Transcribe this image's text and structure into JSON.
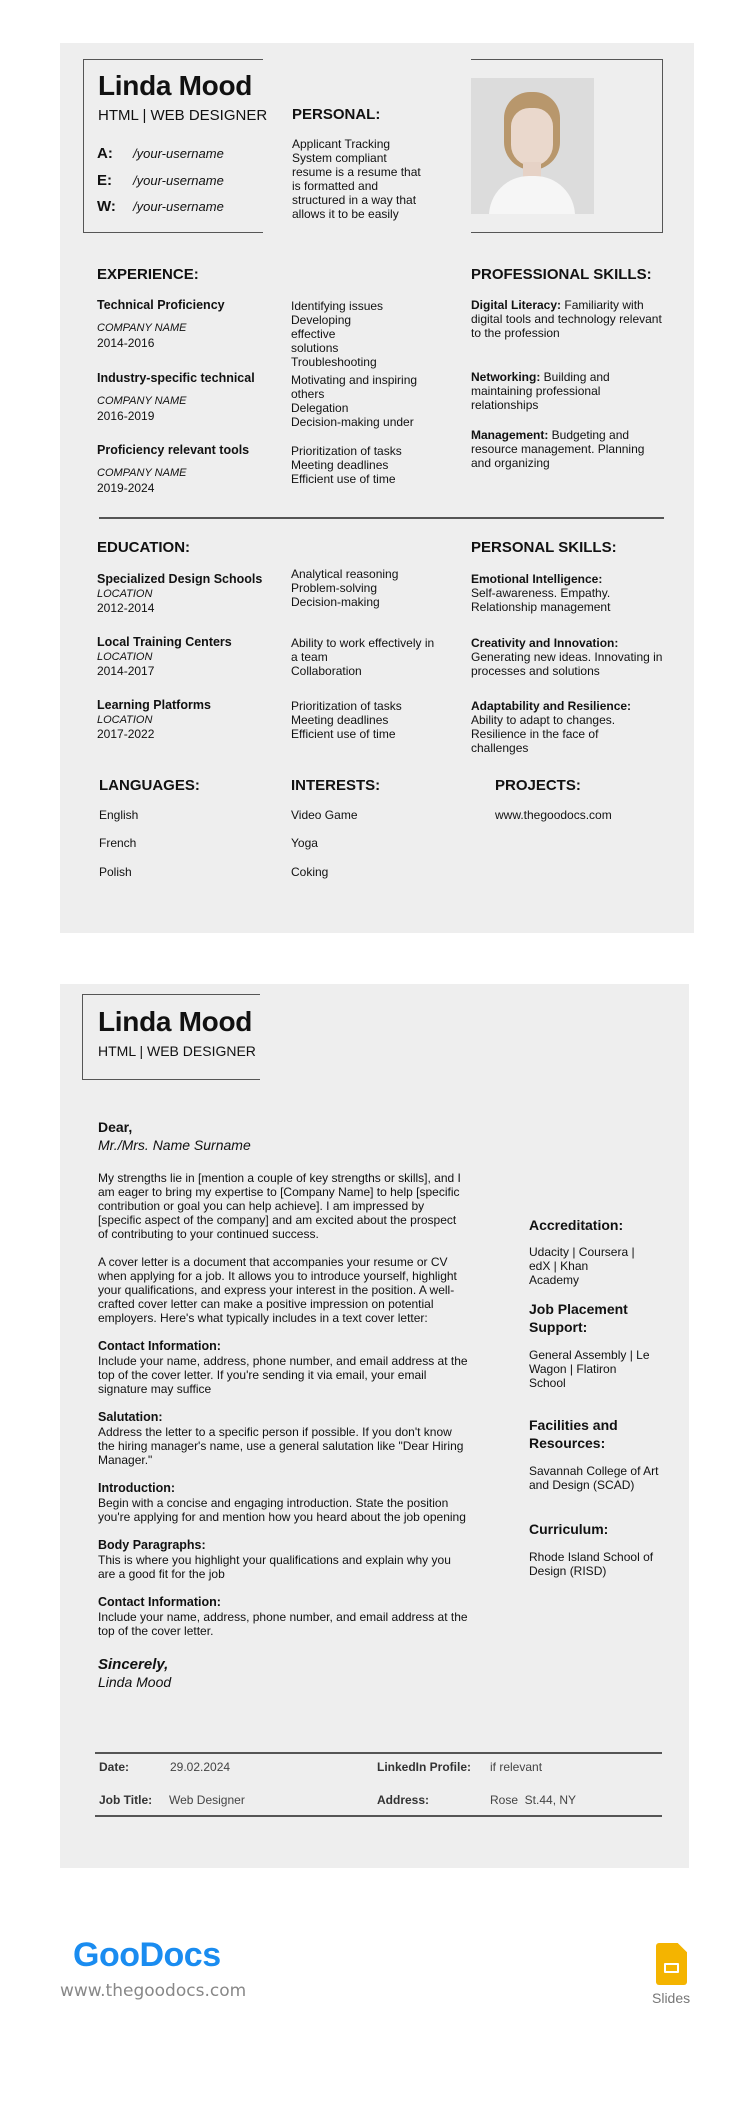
{
  "resume": {
    "name": "Linda Mood",
    "subtitle": "HTML | WEB DESIGNER",
    "contacts": [
      {
        "label": "A:",
        "value": "/your-username"
      },
      {
        "label": "E:",
        "value": "/your-username"
      },
      {
        "label": "W:",
        "value": "/your-username"
      }
    ],
    "personal": {
      "heading": "PERSONAL:",
      "text": "Applicant Tracking System compliant resume is a resume that is formatted and structured in a way that allows it to be easily"
    },
    "experience": {
      "heading": "EXPERIENCE:",
      "items": [
        {
          "title": "Technical Proficiency",
          "company": "COMPANY NAME",
          "years": "2014-2016",
          "skills": [
            "Identifying issues",
            "Developing effective solutions",
            "Troubleshooting"
          ]
        },
        {
          "title": "Industry-specific technical",
          "company": "COMPANY NAME",
          "years": "2016-2019",
          "skills": [
            "Motivating and inspiring others",
            "Delegation",
            "Decision-making under"
          ]
        },
        {
          "title": "Proficiency relevant tools",
          "company": "COMPANY NAME",
          "years": "2019-2024",
          "skills": [
            "Prioritization of tasks",
            "Meeting deadlines",
            "Efficient use of time"
          ]
        }
      ]
    },
    "professional_skills": {
      "heading": "PROFESSIONAL SKILLS:",
      "items": [
        {
          "title": "Digital Literacy:",
          "text": " Familiarity with digital tools and technology relevant to the profession"
        },
        {
          "title": "Networking:",
          "text": " Building and maintaining professional relationships"
        },
        {
          "title": "Management:",
          "text": " Budgeting and resource management. Planning and organizing"
        }
      ]
    },
    "education": {
      "heading": "EDUCATION:",
      "items": [
        {
          "title": "Specialized Design Schools",
          "location": "LOCATION",
          "years": "2012-2014",
          "skills": [
            "Analytical reasoning",
            "Problem-solving",
            "Decision-making"
          ]
        },
        {
          "title": "Local Training Centers",
          "location": "LOCATION",
          "years": "2014-2017",
          "skills": [
            "Ability to work effectively in a team",
            "Collaboration"
          ]
        },
        {
          "title": "Learning Platforms",
          "location": "LOCATION",
          "years": "2017-2022",
          "skills": [
            "Prioritization of tasks",
            "Meeting deadlines",
            "Efficient use of time"
          ]
        }
      ]
    },
    "personal_skills": {
      "heading": "PERSONAL SKILLS:",
      "items": [
        {
          "title": "Emotional Intelligence:",
          "text": "Self-awareness. Empathy. Relationship management"
        },
        {
          "title": "Creativity and Innovation:",
          "text": "Generating new ideas. Innovating in processes and solutions"
        },
        {
          "title": "Adaptability and Resilience:",
          "text": "Ability to adapt to changes. Resilience in the face of challenges"
        }
      ]
    },
    "languages": {
      "heading": "LANGUAGES:",
      "items": [
        "English",
        "French",
        "Polish"
      ]
    },
    "interests": {
      "heading": "INTERESTS:",
      "items": [
        "Video Game",
        "Yoga",
        "Coking"
      ]
    },
    "projects": {
      "heading": "PROJECTS:",
      "items": [
        "www.thegoodocs.com"
      ]
    }
  },
  "letter": {
    "name": "Linda Mood",
    "subtitle": "HTML | WEB DESIGNER",
    "greeting": "Dear,",
    "recipient": "Mr./Mrs. Name Surname",
    "paragraphs": [
      "My strengths lie in [mention a couple of key strengths or skills], and I am eager to bring my expertise to [Company Name] to help [specific contribution or goal you can help achieve]. I am impressed by [specific aspect of the company] and am excited about the prospect of contributing to your continued success.",
      "A cover letter is a document that accompanies your resume or CV when applying for a job. It allows you to introduce yourself, highlight your qualifications, and express your interest in the position. A well-crafted cover letter can make a positive impression on potential employers. Here's what typically includes in a text cover letter:"
    ],
    "sections": [
      {
        "heading": "Contact Information:",
        "text": "Include your name, address, phone number, and email address at the top of the cover letter. If you're sending it via email, your email signature may suffice"
      },
      {
        "heading": "Salutation:",
        "text": "Address the letter to a specific person if possible. If you don't know the hiring manager's name, use a general salutation like \"Dear Hiring Manager.\""
      },
      {
        "heading": "Introduction:",
        "text": "Begin with a concise and engaging introduction. State the position you're applying for and mention how you heard about the job opening"
      },
      {
        "heading": "Body Paragraphs:",
        "text": "This is where you highlight your qualifications and explain why you are a good fit for the job"
      },
      {
        "heading": "Contact Information:",
        "text": "Include your name, address, phone number, and email address at the top of the cover letter."
      }
    ],
    "closing": "Sincerely,",
    "signature": "Linda Mood",
    "sidebar": [
      {
        "heading": "Accreditation:",
        "text": "Udacity | Coursera | edX | Khan Academy"
      },
      {
        "heading": "Job Placement Support:",
        "text": "General Assembly | Le Wagon | Flatiron School"
      },
      {
        "heading": "Facilities and Resources:",
        "text": "Savannah College of Art and Design (SCAD)"
      },
      {
        "heading": "Curriculum:",
        "text": "Rhode Island School of Design (RISD)"
      }
    ],
    "footer": {
      "date_label": "Date:",
      "date": "29.02.2024",
      "linkedin_label": "LinkedIn Profile:",
      "linkedin": "if relevant",
      "job_label": "Job Title:",
      "job": "Web Designer",
      "address_label": "Address:",
      "address": "Rose  St.44, NY"
    }
  },
  "branding": {
    "logo": "GooDocs",
    "url": "www.thegoodocs.com",
    "slides_label": "Slides",
    "logo_color": "#1a8cf0",
    "slides_color": "#f4b400"
  },
  "colors": {
    "page_bg": "#eeeeee",
    "rule": "#555555"
  }
}
